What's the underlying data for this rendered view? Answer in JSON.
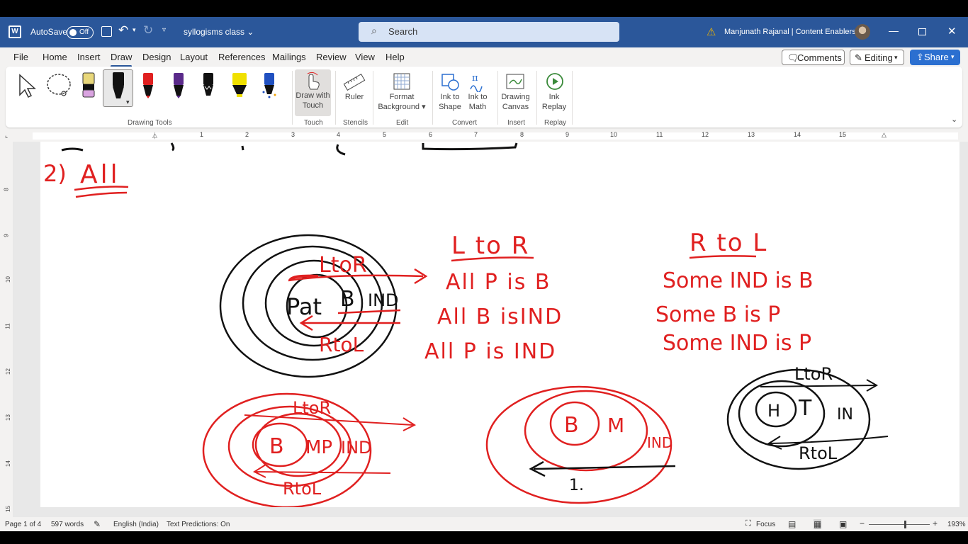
{
  "titlebar": {
    "autosave_label": "AutoSave",
    "autosave_state": "Off",
    "doc_title": "syllogisms class",
    "search_placeholder": "Search",
    "user_name": "Manjunath Rajanal | Content Enablers"
  },
  "menu": {
    "tabs": [
      "File",
      "Home",
      "Insert",
      "Draw",
      "Design",
      "Layout",
      "References",
      "Mailings",
      "Review",
      "View",
      "Help"
    ],
    "active_tab": "Draw",
    "comments_label": "Comments",
    "editing_label": "Editing",
    "share_label": "Share"
  },
  "ribbon": {
    "groups": {
      "drawing_tools": "Drawing Tools",
      "touch": "Touch",
      "stencils": "Stencils",
      "edit": "Edit",
      "convert": "Convert",
      "insert": "Insert",
      "replay": "Replay"
    },
    "buttons": {
      "draw_with_touch_1": "Draw with",
      "draw_with_touch_2": "Touch",
      "ruler": "Ruler",
      "format_background_1": "Format",
      "format_background_2": "Background",
      "ink_to_shape_1": "Ink to",
      "ink_to_shape_2": "Shape",
      "ink_to_math_1": "Ink to",
      "ink_to_math_2": "Math",
      "drawing_canvas_1": "Drawing",
      "drawing_canvas_2": "Canvas",
      "ink_replay_1": "Ink",
      "ink_replay_2": "Replay"
    },
    "pen_colors": [
      "#e8d77a",
      "#111111",
      "#e02020",
      "#5a2a8a",
      "#111111",
      "#f0e000",
      "#2050c0"
    ]
  },
  "ruler": {
    "marks": [
      "1",
      "2",
      "3",
      "4",
      "5",
      "6",
      "7",
      "8",
      "9",
      "10",
      "11",
      "12",
      "13",
      "14",
      "15"
    ],
    "vmarks": [
      "8",
      "9",
      "10",
      "11",
      "12",
      "13",
      "14",
      "15"
    ]
  },
  "ink": {
    "heading_number": "2)",
    "heading_word": "All",
    "top_circle_inner": "Pat",
    "top_circle_mid": "B",
    "top_circle_outer": "IND",
    "top_arrow_right": "LtoR",
    "top_arrow_left": "RtoL",
    "ltor_title": "L to R",
    "ltor_statements": [
      "All  P is B",
      "All  B isIND",
      "All  P  is IND"
    ],
    "rtol_title": "R to L",
    "rtol_statements": [
      "Some IND is B",
      "Some B is  P",
      "Some IND is P"
    ],
    "red_circle1_inner": "B",
    "red_circle1_mid": "MP",
    "red_circle1_outer": "IND",
    "red_circle1_ltor": "LtoR",
    "red_circle1_rtol": "RtoL",
    "red_circle2_inner": "B",
    "red_circle2_mid": "M",
    "red_circle2_outer": "IND",
    "red_circle2_note": "1.",
    "black_circle2_inner": "H",
    "black_circle2_mid": "T",
    "black_circle2_outer": "IN",
    "black_circle2_ltor": "LtoR",
    "black_circle2_rtol": "RtoL",
    "colors": {
      "black_ink": "#111111",
      "red_ink": "#e02020"
    }
  },
  "status": {
    "page": "Page 1 of 4",
    "words": "597 words",
    "language": "English (India)",
    "predictions": "Text Predictions: On",
    "focus": "Focus",
    "zoom": "193%"
  }
}
